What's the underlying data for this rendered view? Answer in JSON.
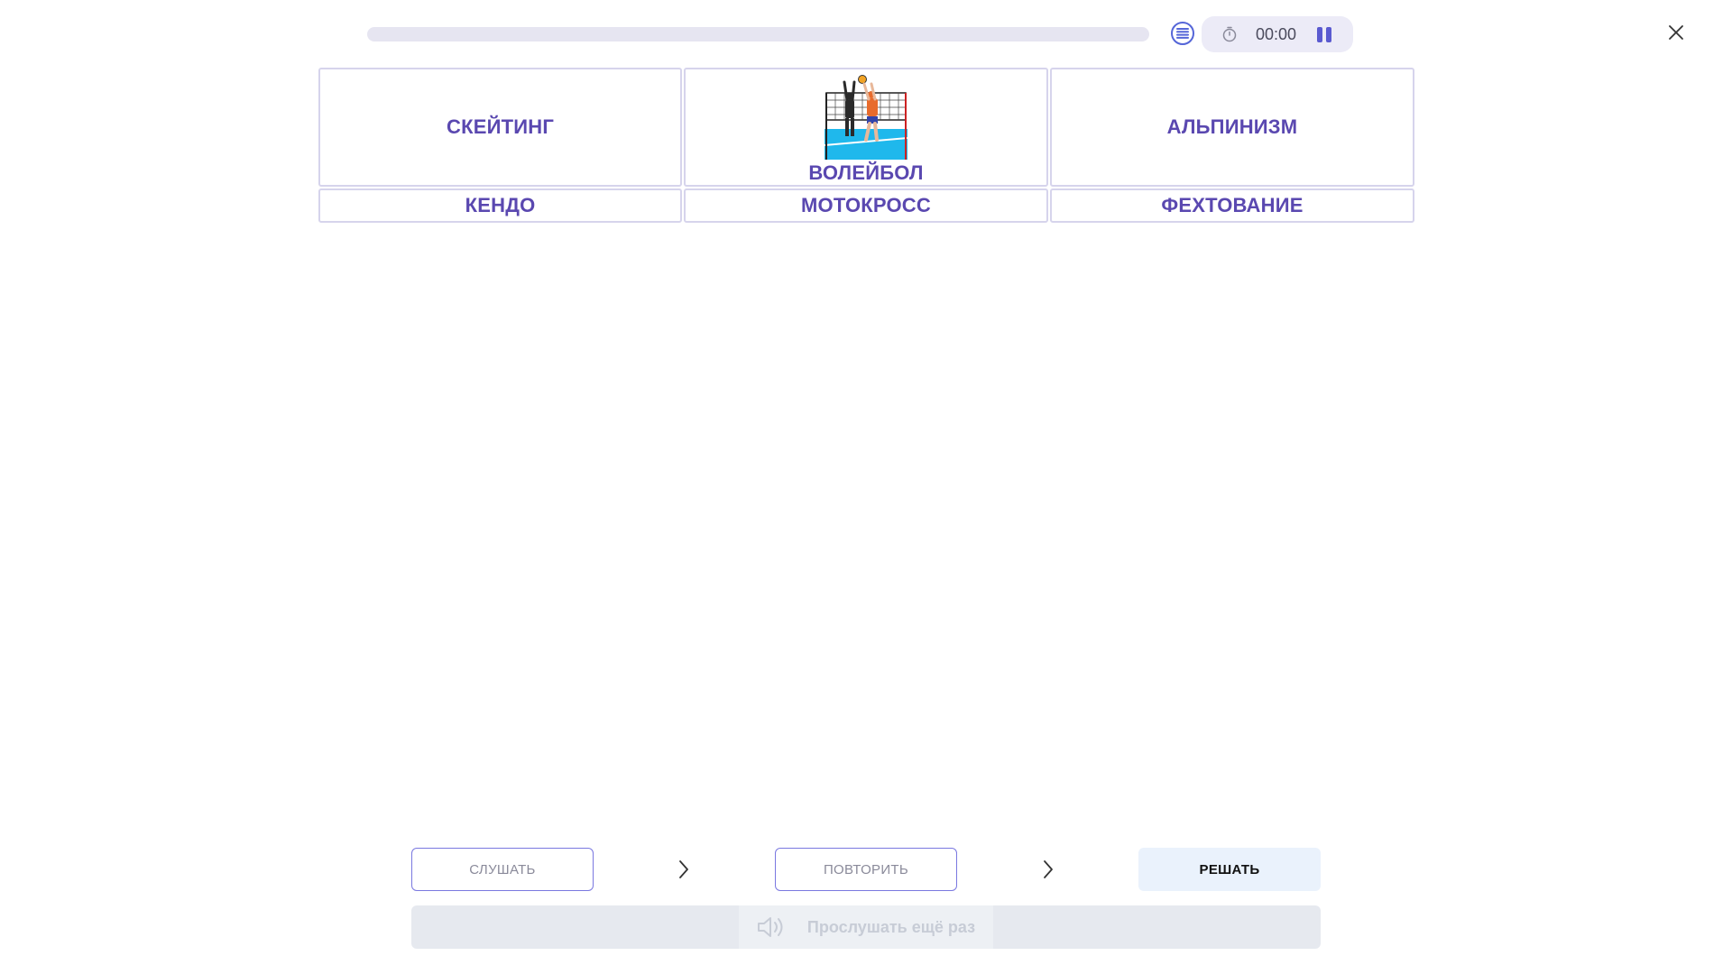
{
  "top_bar": {
    "progress": 0,
    "timer": "00:00",
    "icons": {
      "list": "list-icon",
      "timer": "stopwatch-icon",
      "pause": "pause-icon",
      "close": "close-icon"
    }
  },
  "grid": {
    "row1": [
      {
        "label": "СКЕЙТИНГ"
      },
      {
        "label": "ВОЛЕЙБОЛ",
        "image": "volleyball-players-icon"
      },
      {
        "label": "АЛЬПИНИЗМ"
      }
    ],
    "row2": [
      {
        "label": "КЕНДО"
      },
      {
        "label": "МОТОКРОСС"
      },
      {
        "label": "ФЕХТОВАНИЕ"
      }
    ]
  },
  "controls": {
    "listen": "СЛУШАТЬ",
    "repeat": "ПОВТОРИТЬ",
    "solve": "РЕШАТЬ",
    "listen_again": "Прослушать ещё раз"
  },
  "colors": {
    "accent": "#5a48b0",
    "tile_border": "#d6d4ec",
    "progress_track": "#e6e5f1",
    "timer_pill": "#ecebf7",
    "solve_bg": "#eaf2fc",
    "listen_again_bg": "#e6e9ef"
  }
}
